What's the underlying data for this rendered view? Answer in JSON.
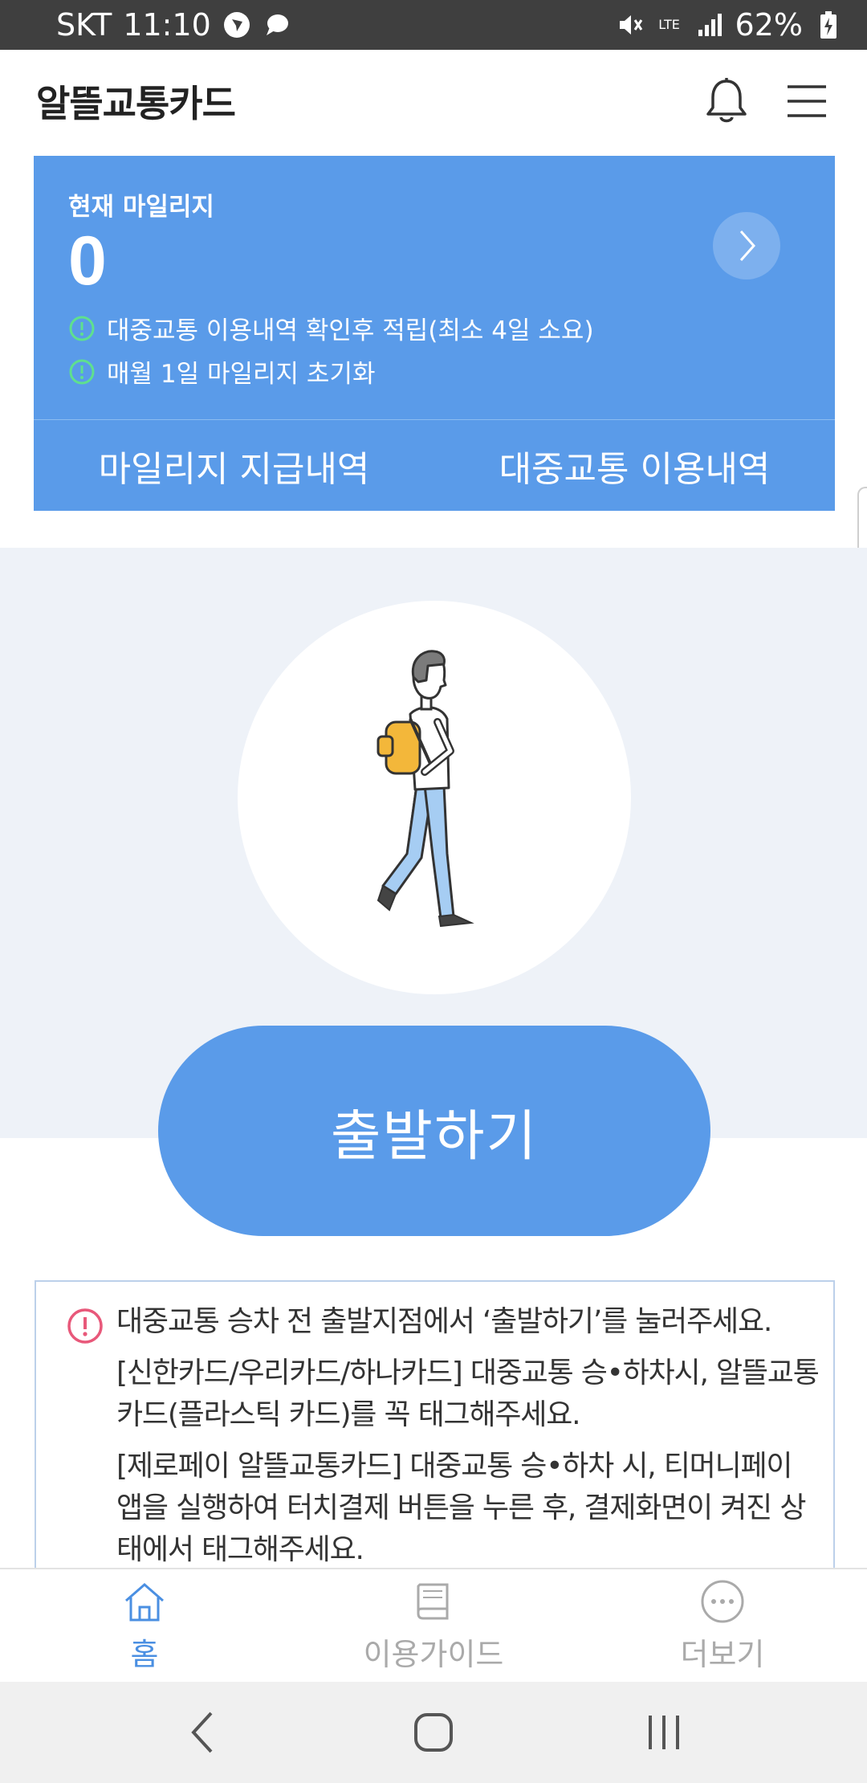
{
  "status_bar": {
    "carrier": "SKT",
    "time": "11:10",
    "network": "LTE",
    "battery": "62%",
    "icons": [
      "navigation-icon",
      "message-icon",
      "mute-icon",
      "signal-icon",
      "battery-charging-icon"
    ]
  },
  "header": {
    "title": "알뜰교통카드",
    "icons": [
      "bell-icon",
      "hamburger-menu-icon"
    ]
  },
  "mileage": {
    "label": "현재 마일리지",
    "value": "0",
    "notices": [
      "대중교통 이용내역 확인후 적립(최소 4일 소요)",
      "매월 1일 마일리지 초기화"
    ],
    "tabs": [
      "마일리지 지급내역",
      "대중교통 이용내역"
    ]
  },
  "hero": {
    "illustration": "walking-person-illustration",
    "depart_button": "출발하기"
  },
  "info": {
    "lines": [
      "대중교통 승차 전 출발지점에서 ‘출발하기’를 눌러주세요.",
      "[신한카드/우리카드/하나카드] 대중교통 승•하차시, 알뜰교통카드(플라스틱 카드)를 꼭 태그해주세요.",
      "[제로페이 알뜰교통카드] 대중교통 승•하차 시, 티머니페이 앱을 실행하여 터치결제 버튼을 누른 후, 결제화면이 켜진 상태에서 태그해주세요."
    ]
  },
  "bottom_nav": {
    "items": [
      {
        "label": "홈",
        "icon": "home-icon",
        "active": true
      },
      {
        "label": "이용가이드",
        "icon": "book-icon",
        "active": false
      },
      {
        "label": "더보기",
        "icon": "more-icon",
        "active": false
      }
    ]
  },
  "colors": {
    "primary": "#5a9be9",
    "hero_bg": "#eef2f8",
    "notice_green": "#5fe08e",
    "alert_red": "#e8587a",
    "nav_active": "#4a8fe2"
  }
}
